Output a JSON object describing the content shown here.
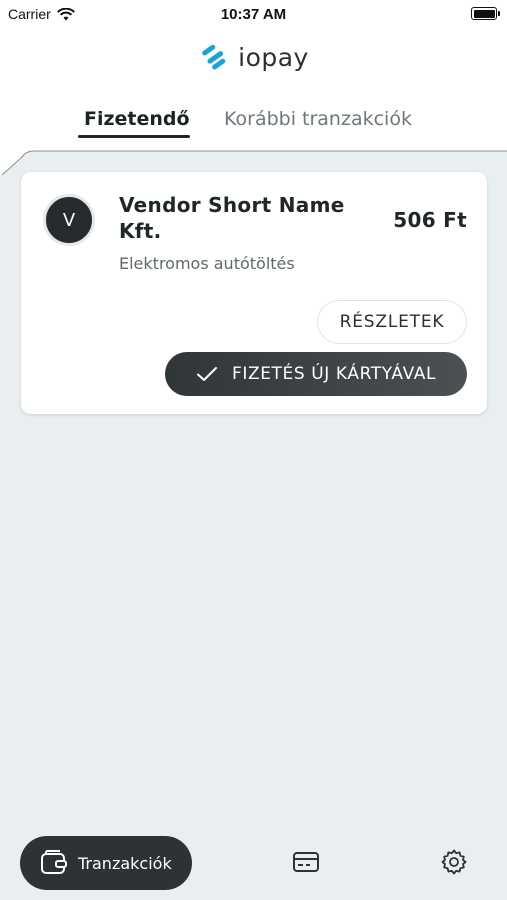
{
  "status_bar": {
    "carrier": "Carrier",
    "time": "10:37 AM"
  },
  "app": {
    "logo_text": "iopay",
    "brand_color": "#1aa3d9"
  },
  "tabs": [
    {
      "label": "Fizetendő",
      "active": true
    },
    {
      "label": "Korábbi tranzakciók",
      "active": false
    }
  ],
  "transaction": {
    "avatar_letter": "V",
    "vendor_name": "Vendor Short Name Kft.",
    "amount": "506 Ft",
    "description": "Elektromos autótöltés",
    "details_label": "RÉSZLETEK",
    "pay_label": "FIZETÉS ÚJ KÁRTYÁVAL"
  },
  "bottom_nav": {
    "transactions_label": "Tranzakciók",
    "icons": [
      "wallet-icon",
      "credit-card-icon",
      "gear-icon"
    ]
  }
}
